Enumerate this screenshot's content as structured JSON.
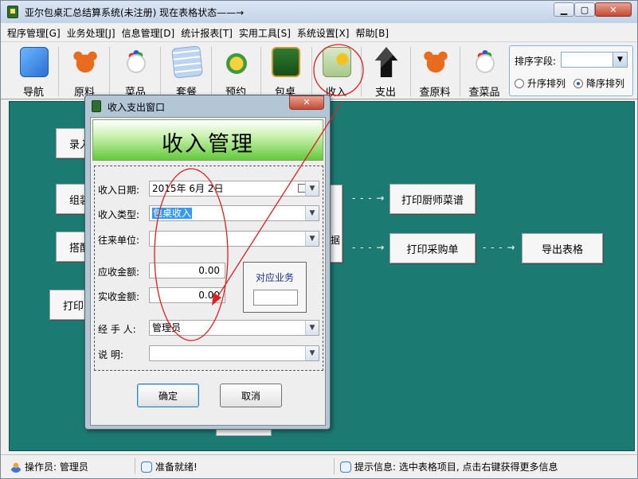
{
  "window": {
    "title": "亚尔包桌汇总结算系统(未注册)  现在表格状态——→",
    "min_glyph": "▁",
    "max_glyph": "▢",
    "close_glyph": "✕"
  },
  "menu": [
    {
      "label": "程序管理[G]"
    },
    {
      "label": "业务处理[J]"
    },
    {
      "label": "信息管理[D]"
    },
    {
      "label": "统计报表[T]"
    },
    {
      "label": "实用工具[S]"
    },
    {
      "label": "系统设置[X]"
    },
    {
      "label": "帮助[B]"
    }
  ],
  "toolbar": [
    {
      "label": "导航",
      "icon": "finder-face-icon"
    },
    {
      "label": "原料",
      "icon": "crab-icon"
    },
    {
      "label": "菜品",
      "icon": "dish-icon"
    },
    {
      "label": "套餐",
      "icon": "set-meal-icon"
    },
    {
      "label": "预约",
      "icon": "reservation-icon"
    },
    {
      "label": "包桌",
      "icon": "banquet-icon"
    },
    {
      "label": "收入",
      "icon": "income-coins-icon"
    },
    {
      "label": "支出",
      "icon": "expense-arrow-icon"
    },
    {
      "label": "查原料",
      "icon": "crab-icon"
    },
    {
      "label": "查菜品",
      "icon": "dish-icon"
    }
  ],
  "sort": {
    "label": "排序字段:",
    "value": "",
    "asc_label": "升序排列",
    "desc_label": "降序排列",
    "selected": "desc"
  },
  "workspace": {
    "buttons": [
      {
        "label": "录入"
      },
      {
        "label": "组装"
      },
      {
        "label": "搭配"
      },
      {
        "label": "打印"
      },
      {
        "label": "打印厨师菜谱"
      },
      {
        "label": "打印采购单"
      },
      {
        "label": "导出表格"
      },
      {
        "label": "据"
      }
    ],
    "arrow": "- - - →"
  },
  "dialog": {
    "title": "收入支出窗口",
    "close_glyph": "✕",
    "header": "收入管理",
    "fields": {
      "date_label": "收入日期:",
      "date_value": "2015年  6月  2日",
      "type_label": "收入类型:",
      "type_value": "包桌收入",
      "partner_label": "往来单位:",
      "partner_value": "",
      "receivable_label": "应收金额:",
      "receivable_value": "0.00",
      "received_label": "实收金额:",
      "received_value": "0.00",
      "handler_label": "经  手  人:",
      "handler_value": "管理员",
      "note_label": "说      明:",
      "note_value": ""
    },
    "business_label": "对应业务",
    "business_value": "",
    "ok_label": "确定",
    "cancel_label": "取消"
  },
  "status": {
    "operator": "操作员: 管理员",
    "ready": "准备就绪!",
    "hint": "提示信息: 选中表格项目, 点击右键获得更多信息"
  },
  "colors": {
    "workspace": "#1b7b73",
    "annotation": "#e02020",
    "header_green": "#64c93b"
  }
}
